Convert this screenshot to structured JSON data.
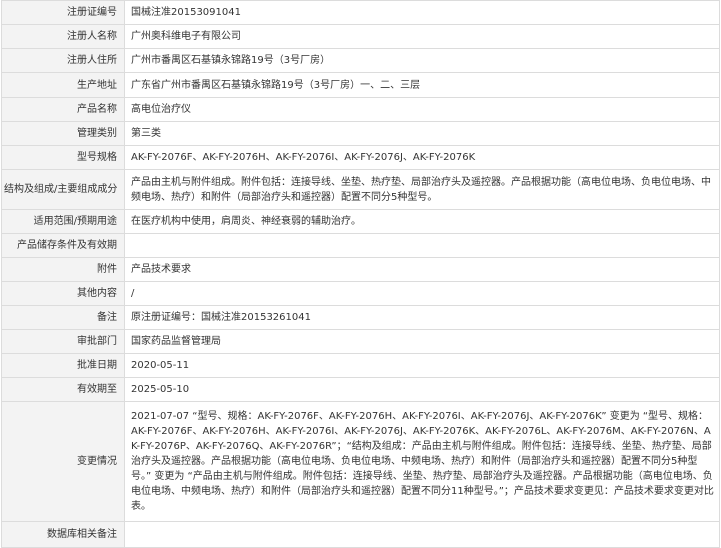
{
  "rows": [
    {
      "label": "注册证编号",
      "value": "国械注准20153091041"
    },
    {
      "label": "注册人名称",
      "value": "广州奥科维电子有限公司"
    },
    {
      "label": "注册人住所",
      "value": "广州市番禺区石基镇永锦路19号（3号厂房）"
    },
    {
      "label": "生产地址",
      "value": "广东省广州市番禺区石基镇永锦路19号（3号厂房）一、二、三层"
    },
    {
      "label": "产品名称",
      "value": "高电位治疗仪"
    },
    {
      "label": "管理类别",
      "value": "第三类"
    },
    {
      "label": "型号规格",
      "value": "AK-FY-2076F、AK-FY-2076H、AK-FY-2076I、AK-FY-2076J、AK-FY-2076K"
    },
    {
      "label": "结构及组成/主要组成成分",
      "value": "产品由主机与附件组成。附件包括：连接导线、坐垫、热疗垫、局部治疗头及遥控器。产品根据功能（高电位电场、负电位电场、中频电场、热疗）和附件（局部治疗头和遥控器）配置不同分5种型号。"
    },
    {
      "label": "适用范围/预期用途",
      "value": "在医疗机构中使用，肩周炎、神经衰弱的辅助治疗。"
    },
    {
      "label": "产品储存条件及有效期",
      "value": ""
    },
    {
      "label": "附件",
      "value": "产品技术要求"
    },
    {
      "label": "其他内容",
      "value": "/"
    },
    {
      "label": "备注",
      "value": "原注册证编号：国械注准20153261041"
    },
    {
      "label": "审批部门",
      "value": "国家药品监督管理局"
    },
    {
      "label": "批准日期",
      "value": "2020-05-11"
    },
    {
      "label": "有效期至",
      "value": "2025-05-10"
    },
    {
      "label": "变更情况",
      "value": "2021-07-07 “型号、规格：AK-FY-2076F、AK-FY-2076H、AK-FY-2076I、AK-FY-2076J、AK-FY-2076K” 变更为 “型号、规格：AK-FY-2076F、AK-FY-2076H、AK-FY-2076I、AK-FY-2076J、AK-FY-2076K、AK-FY-2076L、AK-FY-2076M、AK-FY-2076N、AK-FY-2076P、AK-FY-2076Q、AK-FY-2076R”；“结构及组成：产品由主机与附件组成。附件包括：连接导线、坐垫、热疗垫、局部治疗头及遥控器。产品根据功能（高电位电场、负电位电场、中频电场、热疗）和附件（局部治疗头和遥控器）配置不同分5种型号。” 变更为 “产品由主机与附件组成。附件包括：连接导线、坐垫、热疗垫、局部治疗头及遥控器。产品根据功能（高电位电场、负电位电场、中频电场、热疗）和附件（局部治疗头和遥控器）配置不同分11种型号。”；产品技术要求变更见：产品技术要求变更对比表。"
    },
    {
      "label": "数据库相关备注",
      "value": ""
    }
  ]
}
